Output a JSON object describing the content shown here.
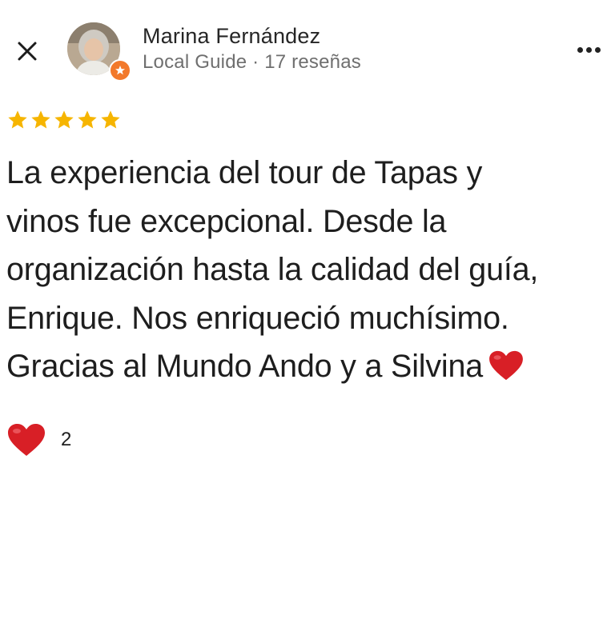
{
  "header": {
    "close_icon": "close-icon",
    "user_name": "Marina Fernández",
    "user_meta": "Local Guide · 17 reseñas",
    "badge_icon": "local-guide-star-icon",
    "more_icon": "more-horizontal-icon"
  },
  "review": {
    "rating": 5,
    "rating_max": 5,
    "star_color": "#f6b500",
    "lines": [
      "La experiencia del tour de Tapas y",
      "vinos fue excepcional. Desde la",
      "organización hasta la calidad del guía,",
      "Enrique. Nos enriqueció muchísimo.",
      "Gracias al Mundo Ando y a Silvina"
    ],
    "trailing_emoji": "heart-emoji-icon"
  },
  "reactions": {
    "icon": "heart-emoji-icon",
    "count": "2"
  },
  "colors": {
    "badge": "#f2792b",
    "heart": "#d81f26",
    "text": "#1e1e1e",
    "meta": "#6f6f6f"
  }
}
